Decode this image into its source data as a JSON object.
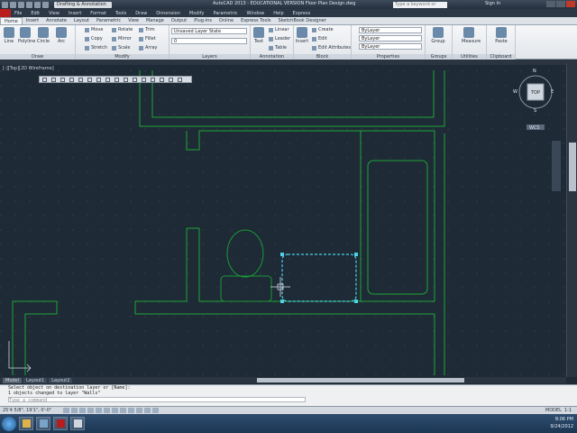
{
  "window": {
    "workspace": "Drafting & Annotation",
    "title": "AutoCAD 2013 - EDUCATIONAL VERSION   Floor Plan Design.dwg",
    "search_placeholder": "Type a keyword or phrase",
    "sign_in": "Sign In"
  },
  "menu": [
    "File",
    "Edit",
    "View",
    "Insert",
    "Format",
    "Tools",
    "Draw",
    "Dimension",
    "Modify",
    "Parametric",
    "Window",
    "Help",
    "Express"
  ],
  "tabs": [
    "Home",
    "Insert",
    "Annotate",
    "Layout",
    "Parametric",
    "View",
    "Manage",
    "Output",
    "Plug-ins",
    "Online",
    "Express Tools",
    "SketchBook Designer"
  ],
  "ribbon": {
    "draw": {
      "title": "Draw",
      "tools": [
        "Line",
        "Polyline",
        "Circle",
        "Arc"
      ]
    },
    "modify": {
      "title": "Modify",
      "tools": [
        "Move",
        "Rotate",
        "Trim",
        "Copy",
        "Mirror",
        "Fillet",
        "Stretch",
        "Scale",
        "Array"
      ]
    },
    "layers": {
      "title": "Layers",
      "layer_state": "Unsaved Layer State",
      "current_layer": "0"
    },
    "annotation": {
      "title": "Annotation",
      "tools": [
        "Text",
        "Linear",
        "Leader",
        "Table"
      ]
    },
    "block": {
      "title": "Block",
      "tools": [
        "Insert",
        "Create",
        "Edit",
        "Edit Attributes"
      ]
    },
    "properties": {
      "title": "Properties",
      "color": "ByLayer",
      "linetype": "ByLayer",
      "lineweight": "ByLayer"
    },
    "groups": {
      "title": "Groups",
      "tool": "Group"
    },
    "utilities": {
      "title": "Utilities",
      "tool": "Measure"
    },
    "clipboard": {
      "title": "Clipboard",
      "tool": "Paste"
    }
  },
  "viewport_label": "[-][Top][2D Wireframe]",
  "viewcube": {
    "n": "N",
    "s": "S",
    "e": "E",
    "w": "W",
    "face": "TOP",
    "wcs": "WCS"
  },
  "layout_tabs": [
    "Model",
    "Layout1",
    "Layout2"
  ],
  "command": {
    "history": [
      "Select object on destination layer or [Name]:",
      "1 objects changed to layer \"Walls\""
    ],
    "placeholder": "Type a command"
  },
  "status": {
    "coords": "25'4 5/8\", 19'1\", 0'-0\"",
    "model": "MODEL",
    "scale": "1:1"
  },
  "taskbar": {
    "time": "8:06 PM",
    "date": "9/24/2012"
  },
  "colors": {
    "canvas": "#1e2a36",
    "walls": "#1fa637",
    "selected": "#4fd1e8",
    "furniture": "#1fa637"
  }
}
